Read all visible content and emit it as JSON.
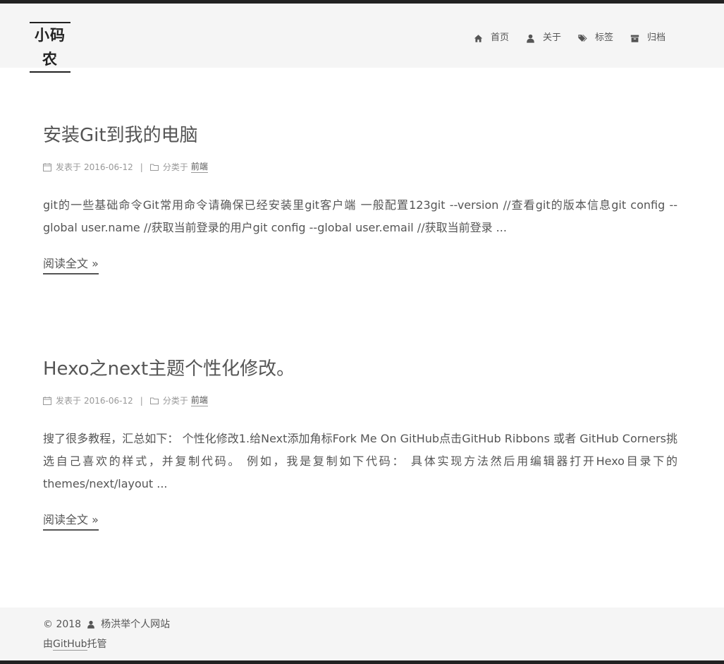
{
  "site": {
    "title": "小码农"
  },
  "menu": {
    "items": [
      {
        "label": "首页",
        "icon": "home-icon"
      },
      {
        "label": "关于",
        "icon": "user-icon"
      },
      {
        "label": "标签",
        "icon": "tags-icon"
      },
      {
        "label": "归档",
        "icon": "archive-icon"
      }
    ]
  },
  "posts": [
    {
      "title": "安装Git到我的电脑",
      "posted_label": "发表于",
      "date": "2016-06-12",
      "divider": "|",
      "category_label": "分类于",
      "category": "前端",
      "excerpt": "git的一些基础命令Git常用命令请确保已经安装里git客户端 一般配置123git --version //查看git的版本信息git config --global user.name //获取当前登录的用户git config --global user.email //获取当前登录 ...",
      "read_more": "阅读全文 »"
    },
    {
      "title": "Hexo之next主题个性化修改。",
      "posted_label": "发表于",
      "date": "2016-06-12",
      "divider": "|",
      "category_label": "分类于",
      "category": "前端",
      "excerpt": "搜了很多教程，汇总如下： 个性化修改1.给Next添加角标Fork Me On GitHub点击GitHub Ribbons 或者 GitHub Corners挑选自己喜欢的样式，并复制代码。 例如，我是复制如下代码： 具体实现方法然后用编辑器打开Hexo目录下的themes/next/layout ...",
      "read_more": "阅读全文 »"
    }
  ],
  "footer": {
    "copyright": "© 2018",
    "author": "杨洪举个人网站",
    "hosted_prefix": "由",
    "hosted_link": "GitHub",
    "hosted_suffix": "托管"
  }
}
